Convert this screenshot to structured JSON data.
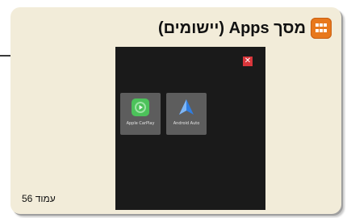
{
  "card": {
    "title": "מסך Apps (יישומים)",
    "icon": "apps-grid-icon"
  },
  "screen": {
    "close_icon": "close-x-icon",
    "close_symbol": "✕",
    "tiles": [
      {
        "label": "Apple CarPlay",
        "icon": "carplay-icon",
        "color": "#4cc25a"
      },
      {
        "label": "Android Auto",
        "icon": "android-auto-icon",
        "color": "#2f7de1"
      }
    ]
  },
  "footer": {
    "page_label": "עמוד 56"
  },
  "colors": {
    "card_bg": "#f2ecd9",
    "accent_orange": "#e8781c",
    "screen_bg": "#1a1a1a",
    "close_red": "#d9363b"
  }
}
